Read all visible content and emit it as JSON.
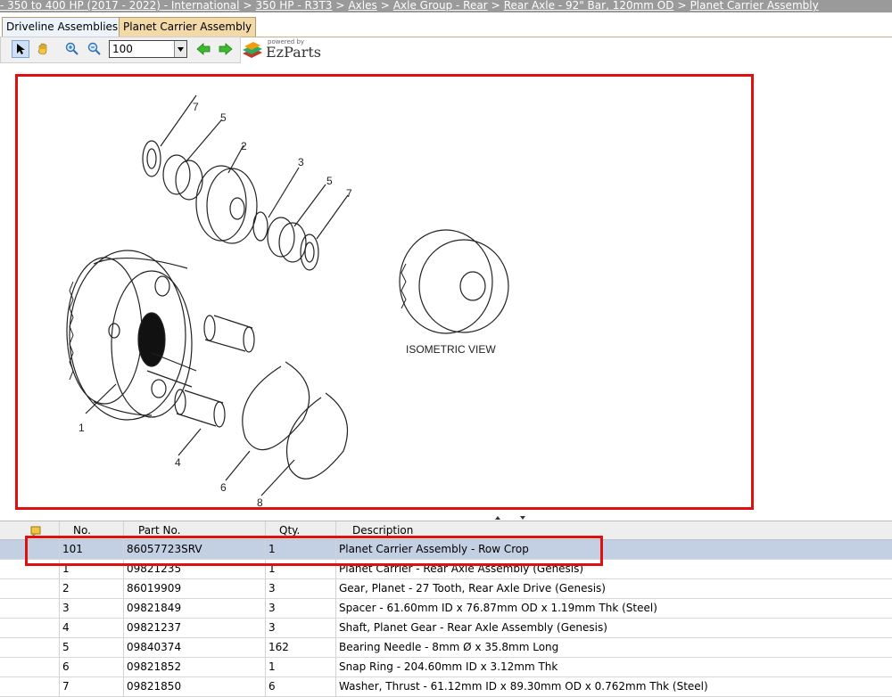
{
  "breadcrumb": [
    "- 350 to 400 HP (2017 - 2022) - International",
    "350 HP - R3T3",
    "Axles",
    "Axle Group - Rear",
    "Rear Axle - 92\" Bar, 120mm OD",
    "Planet Carrier Assembly"
  ],
  "breadcrumb_sep": ">",
  "tabs": [
    {
      "label": "Driveline Assemblies",
      "active": true
    },
    {
      "label": "Planet Carrier Assembly",
      "active": false
    }
  ],
  "toolbar": {
    "zoom_value": "100",
    "icons": [
      "pointer-icon",
      "hand-icon",
      "zoom-in-icon",
      "zoom-out-icon",
      "back-arrow-icon",
      "forward-arrow-icon"
    ]
  },
  "logo": {
    "small": "powered by",
    "name": "EzParts"
  },
  "diagram": {
    "label": "ISOMETRIC VIEW",
    "callouts": [
      "7",
      "5",
      "2",
      "3",
      "5",
      "7",
      "1",
      "4",
      "6",
      "8"
    ]
  },
  "table": {
    "headers": {
      "no": "No.",
      "part": "Part No.",
      "qty": "Qty.",
      "desc": "Description"
    },
    "rows": [
      {
        "no": "101",
        "part": "86057723SRV",
        "qty": "1",
        "desc": "Planet Carrier Assembly - Row Crop"
      },
      {
        "no": "1",
        "part": "09821235",
        "qty": "1",
        "desc": "Planet Carrier - Rear Axle Assembly (Genesis)"
      },
      {
        "no": "2",
        "part": "86019909",
        "qty": "3",
        "desc": "Gear, Planet - 27 Tooth, Rear Axle Drive (Genesis)"
      },
      {
        "no": "3",
        "part": "09821849",
        "qty": "3",
        "desc": "Spacer - 61.60mm ID x 76.87mm OD x 1.19mm Thk (Steel)"
      },
      {
        "no": "4",
        "part": "09821237",
        "qty": "3",
        "desc": "Shaft, Planet Gear - Rear Axle Assembly (Genesis)"
      },
      {
        "no": "5",
        "part": "09840374",
        "qty": "162",
        "desc": "Bearing Needle - 8mm Ø x 35.8mm Long"
      },
      {
        "no": "6",
        "part": "09821852",
        "qty": "1",
        "desc": "Snap Ring - 204.60mm ID x 3.12mm Thk"
      },
      {
        "no": "7",
        "part": "09821850",
        "qty": "6",
        "desc": "Washer, Thrust - 61.12mm ID x 89.30mm OD x 0.762mm Thk (Steel)"
      }
    ]
  },
  "colors": {
    "highlight": "#e01010",
    "selected_row": "#c3cfe3",
    "breadcrumb_bg": "#9a9a9a"
  }
}
